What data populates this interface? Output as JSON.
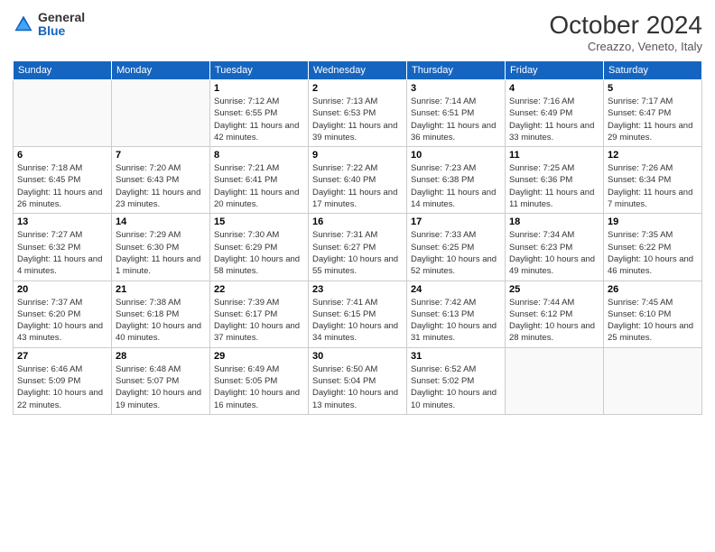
{
  "header": {
    "logo_general": "General",
    "logo_blue": "Blue",
    "month": "October 2024",
    "location": "Creazzo, Veneto, Italy"
  },
  "weekdays": [
    "Sunday",
    "Monday",
    "Tuesday",
    "Wednesday",
    "Thursday",
    "Friday",
    "Saturday"
  ],
  "weeks": [
    [
      {
        "day": null,
        "sunrise": null,
        "sunset": null,
        "daylight": null
      },
      {
        "day": null,
        "sunrise": null,
        "sunset": null,
        "daylight": null
      },
      {
        "day": "1",
        "sunrise": "Sunrise: 7:12 AM",
        "sunset": "Sunset: 6:55 PM",
        "daylight": "Daylight: 11 hours and 42 minutes."
      },
      {
        "day": "2",
        "sunrise": "Sunrise: 7:13 AM",
        "sunset": "Sunset: 6:53 PM",
        "daylight": "Daylight: 11 hours and 39 minutes."
      },
      {
        "day": "3",
        "sunrise": "Sunrise: 7:14 AM",
        "sunset": "Sunset: 6:51 PM",
        "daylight": "Daylight: 11 hours and 36 minutes."
      },
      {
        "day": "4",
        "sunrise": "Sunrise: 7:16 AM",
        "sunset": "Sunset: 6:49 PM",
        "daylight": "Daylight: 11 hours and 33 minutes."
      },
      {
        "day": "5",
        "sunrise": "Sunrise: 7:17 AM",
        "sunset": "Sunset: 6:47 PM",
        "daylight": "Daylight: 11 hours and 29 minutes."
      }
    ],
    [
      {
        "day": "6",
        "sunrise": "Sunrise: 7:18 AM",
        "sunset": "Sunset: 6:45 PM",
        "daylight": "Daylight: 11 hours and 26 minutes."
      },
      {
        "day": "7",
        "sunrise": "Sunrise: 7:20 AM",
        "sunset": "Sunset: 6:43 PM",
        "daylight": "Daylight: 11 hours and 23 minutes."
      },
      {
        "day": "8",
        "sunrise": "Sunrise: 7:21 AM",
        "sunset": "Sunset: 6:41 PM",
        "daylight": "Daylight: 11 hours and 20 minutes."
      },
      {
        "day": "9",
        "sunrise": "Sunrise: 7:22 AM",
        "sunset": "Sunset: 6:40 PM",
        "daylight": "Daylight: 11 hours and 17 minutes."
      },
      {
        "day": "10",
        "sunrise": "Sunrise: 7:23 AM",
        "sunset": "Sunset: 6:38 PM",
        "daylight": "Daylight: 11 hours and 14 minutes."
      },
      {
        "day": "11",
        "sunrise": "Sunrise: 7:25 AM",
        "sunset": "Sunset: 6:36 PM",
        "daylight": "Daylight: 11 hours and 11 minutes."
      },
      {
        "day": "12",
        "sunrise": "Sunrise: 7:26 AM",
        "sunset": "Sunset: 6:34 PM",
        "daylight": "Daylight: 11 hours and 7 minutes."
      }
    ],
    [
      {
        "day": "13",
        "sunrise": "Sunrise: 7:27 AM",
        "sunset": "Sunset: 6:32 PM",
        "daylight": "Daylight: 11 hours and 4 minutes."
      },
      {
        "day": "14",
        "sunrise": "Sunrise: 7:29 AM",
        "sunset": "Sunset: 6:30 PM",
        "daylight": "Daylight: 11 hours and 1 minute."
      },
      {
        "day": "15",
        "sunrise": "Sunrise: 7:30 AM",
        "sunset": "Sunset: 6:29 PM",
        "daylight": "Daylight: 10 hours and 58 minutes."
      },
      {
        "day": "16",
        "sunrise": "Sunrise: 7:31 AM",
        "sunset": "Sunset: 6:27 PM",
        "daylight": "Daylight: 10 hours and 55 minutes."
      },
      {
        "day": "17",
        "sunrise": "Sunrise: 7:33 AM",
        "sunset": "Sunset: 6:25 PM",
        "daylight": "Daylight: 10 hours and 52 minutes."
      },
      {
        "day": "18",
        "sunrise": "Sunrise: 7:34 AM",
        "sunset": "Sunset: 6:23 PM",
        "daylight": "Daylight: 10 hours and 49 minutes."
      },
      {
        "day": "19",
        "sunrise": "Sunrise: 7:35 AM",
        "sunset": "Sunset: 6:22 PM",
        "daylight": "Daylight: 10 hours and 46 minutes."
      }
    ],
    [
      {
        "day": "20",
        "sunrise": "Sunrise: 7:37 AM",
        "sunset": "Sunset: 6:20 PM",
        "daylight": "Daylight: 10 hours and 43 minutes."
      },
      {
        "day": "21",
        "sunrise": "Sunrise: 7:38 AM",
        "sunset": "Sunset: 6:18 PM",
        "daylight": "Daylight: 10 hours and 40 minutes."
      },
      {
        "day": "22",
        "sunrise": "Sunrise: 7:39 AM",
        "sunset": "Sunset: 6:17 PM",
        "daylight": "Daylight: 10 hours and 37 minutes."
      },
      {
        "day": "23",
        "sunrise": "Sunrise: 7:41 AM",
        "sunset": "Sunset: 6:15 PM",
        "daylight": "Daylight: 10 hours and 34 minutes."
      },
      {
        "day": "24",
        "sunrise": "Sunrise: 7:42 AM",
        "sunset": "Sunset: 6:13 PM",
        "daylight": "Daylight: 10 hours and 31 minutes."
      },
      {
        "day": "25",
        "sunrise": "Sunrise: 7:44 AM",
        "sunset": "Sunset: 6:12 PM",
        "daylight": "Daylight: 10 hours and 28 minutes."
      },
      {
        "day": "26",
        "sunrise": "Sunrise: 7:45 AM",
        "sunset": "Sunset: 6:10 PM",
        "daylight": "Daylight: 10 hours and 25 minutes."
      }
    ],
    [
      {
        "day": "27",
        "sunrise": "Sunrise: 6:46 AM",
        "sunset": "Sunset: 5:09 PM",
        "daylight": "Daylight: 10 hours and 22 minutes."
      },
      {
        "day": "28",
        "sunrise": "Sunrise: 6:48 AM",
        "sunset": "Sunset: 5:07 PM",
        "daylight": "Daylight: 10 hours and 19 minutes."
      },
      {
        "day": "29",
        "sunrise": "Sunrise: 6:49 AM",
        "sunset": "Sunset: 5:05 PM",
        "daylight": "Daylight: 10 hours and 16 minutes."
      },
      {
        "day": "30",
        "sunrise": "Sunrise: 6:50 AM",
        "sunset": "Sunset: 5:04 PM",
        "daylight": "Daylight: 10 hours and 13 minutes."
      },
      {
        "day": "31",
        "sunrise": "Sunrise: 6:52 AM",
        "sunset": "Sunset: 5:02 PM",
        "daylight": "Daylight: 10 hours and 10 minutes."
      },
      {
        "day": null,
        "sunrise": null,
        "sunset": null,
        "daylight": null
      },
      {
        "day": null,
        "sunrise": null,
        "sunset": null,
        "daylight": null
      }
    ]
  ]
}
